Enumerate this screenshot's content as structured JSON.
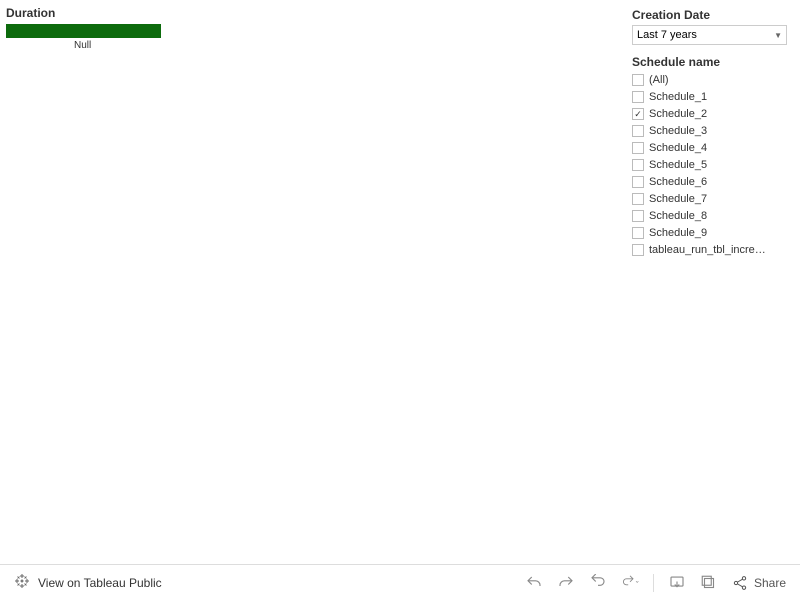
{
  "chart_data": {
    "type": "bar",
    "title": "Duration",
    "categories": [
      "Null"
    ],
    "values": [
      100
    ],
    "color": "#0d6b0d"
  },
  "chart": {
    "title": "Duration",
    "null_label": "Null"
  },
  "filters": {
    "creation_date": {
      "title": "Creation Date",
      "selected": "Last 7 years"
    },
    "schedule_name": {
      "title": "Schedule name",
      "items": [
        {
          "label": "(All)",
          "checked": false
        },
        {
          "label": "Schedule_1",
          "checked": false
        },
        {
          "label": "Schedule_2",
          "checked": true
        },
        {
          "label": "Schedule_3",
          "checked": false
        },
        {
          "label": "Schedule_4",
          "checked": false
        },
        {
          "label": "Schedule_5",
          "checked": false
        },
        {
          "label": "Schedule_6",
          "checked": false
        },
        {
          "label": "Schedule_7",
          "checked": false
        },
        {
          "label": "Schedule_8",
          "checked": false
        },
        {
          "label": "Schedule_9",
          "checked": false
        },
        {
          "label": "tableau_run_tbl_incre…",
          "checked": false
        }
      ]
    }
  },
  "toolbar": {
    "view_text": "View on Tableau Public",
    "share_text": "Share"
  }
}
